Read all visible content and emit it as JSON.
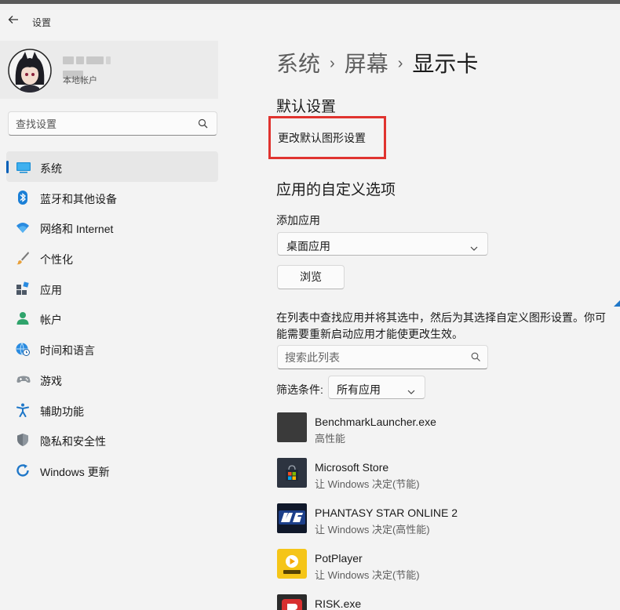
{
  "window": {
    "title": "设置",
    "back_icon": "back-arrow-icon"
  },
  "profile": {
    "account_type": "本地帐户"
  },
  "search": {
    "placeholder": "查找设置",
    "icon": "search-icon"
  },
  "sidebar": {
    "items": [
      {
        "label": "系统",
        "icon": "system-display-icon",
        "active": true
      },
      {
        "label": "蓝牙和其他设备",
        "icon": "bluetooth-icon"
      },
      {
        "label": "网络和 Internet",
        "icon": "wifi-icon"
      },
      {
        "label": "个性化",
        "icon": "brush-icon"
      },
      {
        "label": "应用",
        "icon": "apps-icon"
      },
      {
        "label": "帐户",
        "icon": "account-icon"
      },
      {
        "label": "时间和语言",
        "icon": "globe-clock-icon"
      },
      {
        "label": "游戏",
        "icon": "gamepad-icon"
      },
      {
        "label": "辅助功能",
        "icon": "accessibility-icon"
      },
      {
        "label": "隐私和安全性",
        "icon": "shield-icon"
      },
      {
        "label": "Windows 更新",
        "icon": "windows-update-icon"
      }
    ]
  },
  "breadcrumb": {
    "items": [
      "系统",
      "屏幕",
      "显示卡"
    ],
    "separator": "›"
  },
  "main": {
    "default_settings": {
      "title": "默认设置",
      "link": "更改默认图形设置"
    },
    "custom_options": {
      "title": "应用的自定义选项",
      "add_app_label": "添加应用",
      "app_type_selected": "桌面应用",
      "browse_button": "浏览",
      "description": "在列表中查找应用并将其选中，然后为其选择自定义图形设置。你可能需要重新启动应用才能使更改生效。",
      "list_search_placeholder": "搜索此列表",
      "filter_label": "筛选条件:",
      "filter_selected": "所有应用"
    },
    "apps": [
      {
        "name": "BenchmarkLauncher.exe",
        "preference": "高性能",
        "icon": "benchmark-app-icon"
      },
      {
        "name": "Microsoft Store",
        "preference": "让 Windows 决定(节能)",
        "icon": "microsoft-store-icon"
      },
      {
        "name": "PHANTASY STAR ONLINE 2",
        "preference": "让 Windows 决定(高性能)",
        "icon": "pso2-ngs-icon"
      },
      {
        "name": "PotPlayer",
        "preference": "让 Windows 决定(节能)",
        "icon": "potplayer-icon"
      },
      {
        "name": "RISK.exe",
        "preference": "",
        "icon": "risk-app-icon"
      }
    ]
  },
  "colors": {
    "accent": "#005fb8",
    "highlight_box": "#e0332f",
    "background": "#f3f3f3"
  }
}
